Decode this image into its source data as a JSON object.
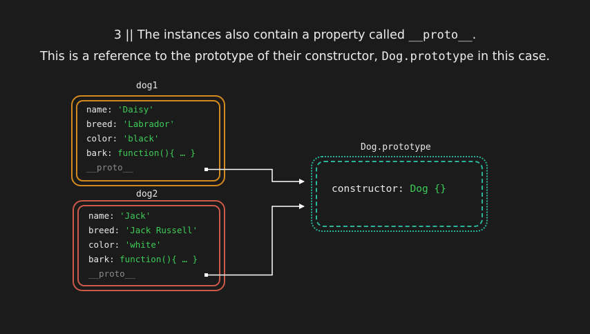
{
  "caption": {
    "line1_prefix": "3 || The instances also contain a property called ",
    "line1_code": "__proto__",
    "line1_suffix": ".",
    "line2_prefix": "This is a reference to the prototype of their constructor, ",
    "line2_code": "Dog.prototype",
    "line2_suffix": " in this case."
  },
  "dog1": {
    "title": "dog1",
    "props": [
      {
        "key": "name: ",
        "value": "'Daisy'"
      },
      {
        "key": "breed: ",
        "value": "'Labrador'"
      },
      {
        "key": "color: ",
        "value": "'black'"
      },
      {
        "key": "bark: ",
        "value": "function(){ … }"
      }
    ],
    "proto": "__proto__"
  },
  "dog2": {
    "title": "dog2",
    "props": [
      {
        "key": "name: ",
        "value": "'Jack'"
      },
      {
        "key": "breed: ",
        "value": "'Jack Russell'"
      },
      {
        "key": "color: ",
        "value": "'white'"
      },
      {
        "key": "bark: ",
        "value": "function(){ … }"
      }
    ],
    "proto": "__proto__"
  },
  "prototype": {
    "title": "Dog.prototype",
    "ctor_key": "constructor: ",
    "ctor_value": "Dog {}"
  },
  "colors": {
    "background": "#1b1b1b",
    "dog1_border": "#d58a1f",
    "dog2_border": "#cc5a48",
    "prototype_border": "#2cb59a",
    "value_text": "#3dcc57",
    "proto_text": "#8a8a8a"
  }
}
